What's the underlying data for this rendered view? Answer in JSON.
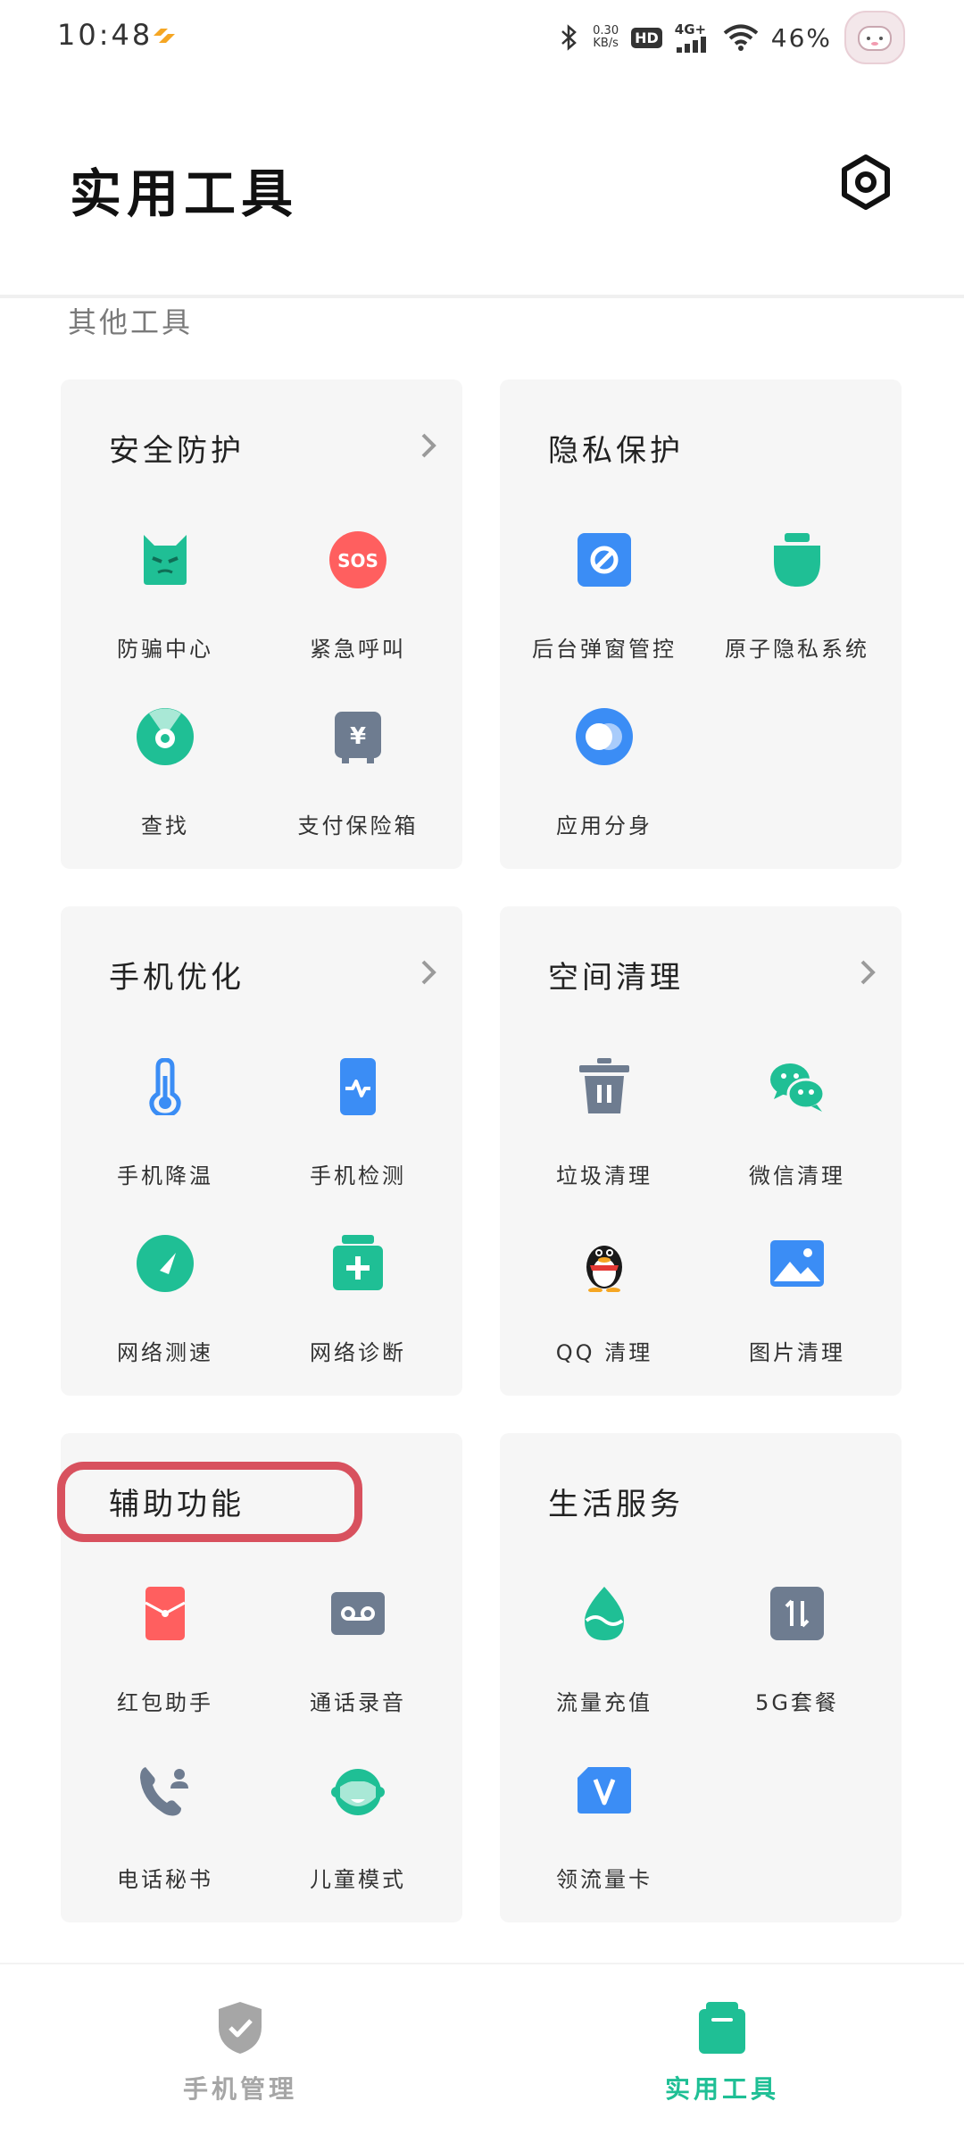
{
  "status_bar": {
    "time": "10:48",
    "net_speed_value": "0.30",
    "net_speed_unit": "KB/s",
    "hd_label": "HD",
    "network": "4G+",
    "battery": "46%"
  },
  "header": {
    "title": "实用工具",
    "settings_icon": "settings-gear-icon"
  },
  "section": {
    "title": "其他工具"
  },
  "cards": [
    {
      "title": "安全防护",
      "has_more": true,
      "tools": [
        {
          "label": "防骗中心",
          "icon": "anti-fraud-icon",
          "color": "#1FBF95"
        },
        {
          "label": "紧急呼叫",
          "icon": "sos-icon",
          "color": "#FF5F5F"
        },
        {
          "label": "查找",
          "icon": "find-device-icon",
          "color": "#1FBF95"
        },
        {
          "label": "支付保险箱",
          "icon": "payment-safe-icon",
          "color": "#6E7C90"
        }
      ]
    },
    {
      "title": "隐私保护",
      "has_more": false,
      "tools": [
        {
          "label": "后台弹窗管控",
          "icon": "popup-block-icon",
          "color": "#3B8DF5"
        },
        {
          "label": "原子隐私系统",
          "icon": "privacy-system-icon",
          "color": "#1FBF95"
        },
        {
          "label": "应用分身",
          "icon": "app-clone-icon",
          "color": "#3B8DF5"
        }
      ]
    },
    {
      "title": "手机优化",
      "has_more": true,
      "tools": [
        {
          "label": "手机降温",
          "icon": "thermometer-icon",
          "color": "#3B8DF5"
        },
        {
          "label": "手机检测",
          "icon": "phone-check-icon",
          "color": "#3B8DF5"
        },
        {
          "label": "网络测速",
          "icon": "speedometer-icon",
          "color": "#1FBF95"
        },
        {
          "label": "网络诊断",
          "icon": "network-diagnosis-icon",
          "color": "#1FBF95"
        }
      ]
    },
    {
      "title": "空间清理",
      "has_more": true,
      "tools": [
        {
          "label": "垃圾清理",
          "icon": "trash-icon",
          "color": "#6E7C90"
        },
        {
          "label": "微信清理",
          "icon": "wechat-icon",
          "color": "#1FBF95"
        },
        {
          "label": "QQ 清理",
          "icon": "qq-penguin-icon",
          "color": "#1a1a1a"
        },
        {
          "label": "图片清理",
          "icon": "image-icon",
          "color": "#3B8DF5"
        }
      ]
    },
    {
      "title": "辅助功能",
      "has_more": false,
      "tools": [
        {
          "label": "红包助手",
          "icon": "red-envelope-icon",
          "color": "#FF5F5F"
        },
        {
          "label": "通话录音",
          "icon": "call-recording-icon",
          "color": "#6E7C90"
        },
        {
          "label": "电话秘书",
          "icon": "phone-secretary-icon",
          "color": "#6E7C90"
        },
        {
          "label": "儿童模式",
          "icon": "kids-mode-icon",
          "color": "#1FBF95"
        }
      ]
    },
    {
      "title": "生活服务",
      "has_more": false,
      "tools": [
        {
          "label": "流量充值",
          "icon": "data-recharge-icon",
          "color": "#1FBF95"
        },
        {
          "label": "5G套餐",
          "icon": "5g-plan-icon",
          "color": "#6E7C90"
        },
        {
          "label": "领流量卡",
          "icon": "data-card-icon",
          "color": "#3B8DF5"
        }
      ]
    }
  ],
  "bottom_nav": [
    {
      "label": "手机管理",
      "icon": "shield-check-icon",
      "active": false,
      "color": "#A6A6A6"
    },
    {
      "label": "实用工具",
      "icon": "toolbox-icon",
      "active": true,
      "color": "#1FBF95"
    }
  ]
}
